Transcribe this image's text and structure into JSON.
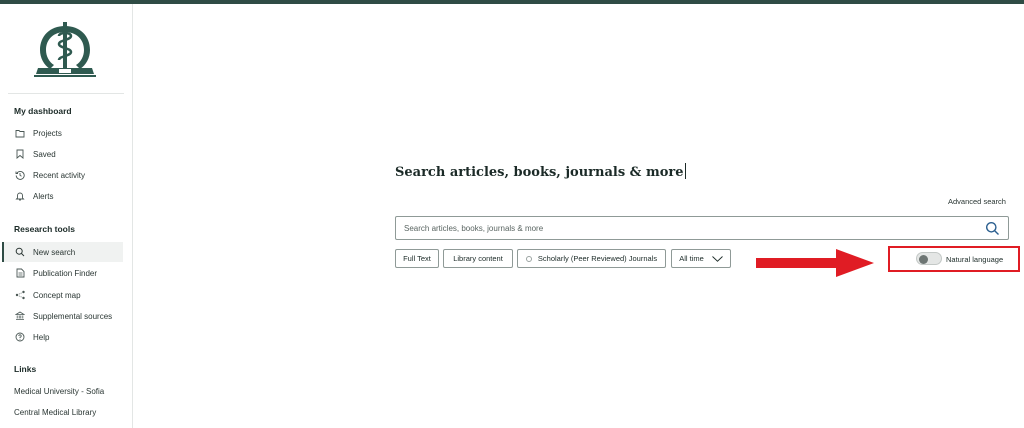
{
  "sidebar": {
    "dashboard_title": "My dashboard",
    "dashboard_items": [
      {
        "label": "Projects",
        "icon": "folder-icon"
      },
      {
        "label": "Saved",
        "icon": "bookmark-icon"
      },
      {
        "label": "Recent activity",
        "icon": "history-icon"
      },
      {
        "label": "Alerts",
        "icon": "bell-icon"
      }
    ],
    "research_title": "Research tools",
    "research_items": [
      {
        "label": "New search",
        "icon": "search-icon",
        "active": true
      },
      {
        "label": "Publication Finder",
        "icon": "document-icon"
      },
      {
        "label": "Concept map",
        "icon": "concept-map-icon"
      },
      {
        "label": "Supplemental sources",
        "icon": "institution-icon"
      },
      {
        "label": "Help",
        "icon": "help-icon"
      }
    ],
    "links_title": "Links",
    "links": [
      "Medical University - Sofia",
      "Central Medical Library"
    ]
  },
  "main": {
    "title": "Search articles, books, journals & more",
    "advanced_search": "Advanced search",
    "search_placeholder": "Search articles, books, journals & more",
    "filters": [
      "Full Text",
      "Library content",
      "Scholarly (Peer Reviewed) Journals",
      "All time"
    ],
    "natural_language_label": "Natural language",
    "natural_language_on": false
  },
  "colors": {
    "brand": "#2f4c45",
    "highlight": "#e01c24",
    "accent_icon": "#2b5f8f"
  }
}
